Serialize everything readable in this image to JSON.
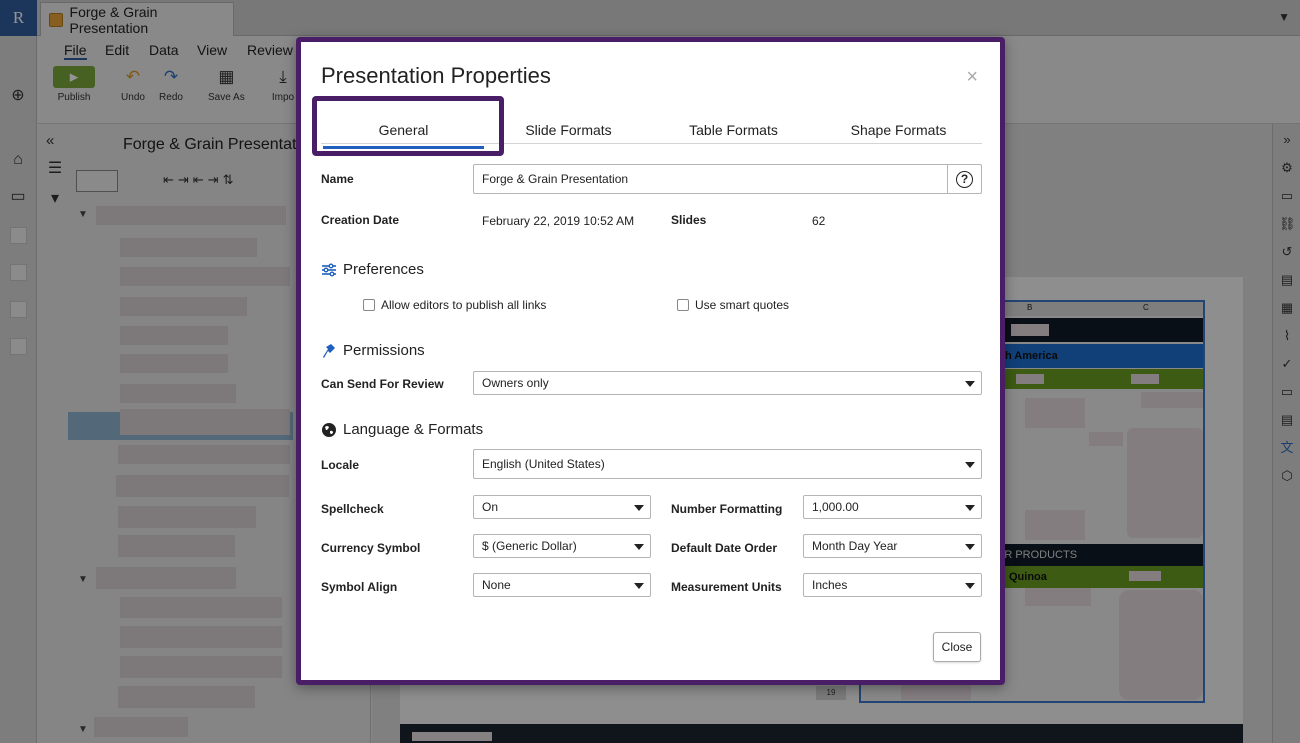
{
  "app": {
    "logo": "R",
    "document_tab": "Forge & Grain Presentation",
    "menus": [
      "File",
      "Edit",
      "Data",
      "View",
      "Review"
    ],
    "toolbar": {
      "publish": "Publish",
      "undo": "Undo",
      "redo": "Redo",
      "save_as": "Save As",
      "import": "Impo"
    },
    "outline_title": "Forge & Grain Presentat"
  },
  "background_sheet": {
    "col_b": "B",
    "col_c": "C",
    "region_label": "rth America",
    "products_label": "ER PRODUCTS",
    "quinoa_label": "Quinoa",
    "row_number": "19"
  },
  "dialog": {
    "title": "Presentation Properties",
    "close_glyph": "×",
    "tabs": [
      {
        "label": "General",
        "active": true
      },
      {
        "label": "Slide Formats",
        "active": false
      },
      {
        "label": "Table Formats",
        "active": false
      },
      {
        "label": "Shape Formats",
        "active": false
      }
    ],
    "name": {
      "label": "Name",
      "value": "Forge & Grain  Presentation",
      "help": "?"
    },
    "creation_date": {
      "label": "Creation Date",
      "value": "February 22, 2019 10:52 AM"
    },
    "slides": {
      "label": "Slides",
      "value": "62"
    },
    "preferences": {
      "heading": "Preferences",
      "allow_publish": {
        "label": "Allow editors to publish all links",
        "checked": false
      },
      "smart_quotes": {
        "label": "Use smart quotes",
        "checked": false
      }
    },
    "permissions": {
      "heading": "Permissions",
      "send_for_review": {
        "label": "Can Send For Review",
        "value": "Owners only"
      }
    },
    "language": {
      "heading": "Language & Formats",
      "locale": {
        "label": "Locale",
        "value": "English (United States)"
      },
      "spellcheck": {
        "label": "Spellcheck",
        "value": "On"
      },
      "number_formatting": {
        "label": "Number Formatting",
        "value": "1,000.00"
      },
      "currency_symbol": {
        "label": "Currency Symbol",
        "value": "$ (Generic Dollar)"
      },
      "date_order": {
        "label": "Default Date Order",
        "value": "Month Day Year"
      },
      "symbol_align": {
        "label": "Symbol Align",
        "value": "None"
      },
      "measurement_units": {
        "label": "Measurement Units",
        "value": "Inches"
      }
    },
    "close_button": "Close"
  },
  "colors": {
    "accent": "#1f5fbf",
    "focus_ring": "#4a1e66",
    "publish_green": "#7ba83b"
  }
}
